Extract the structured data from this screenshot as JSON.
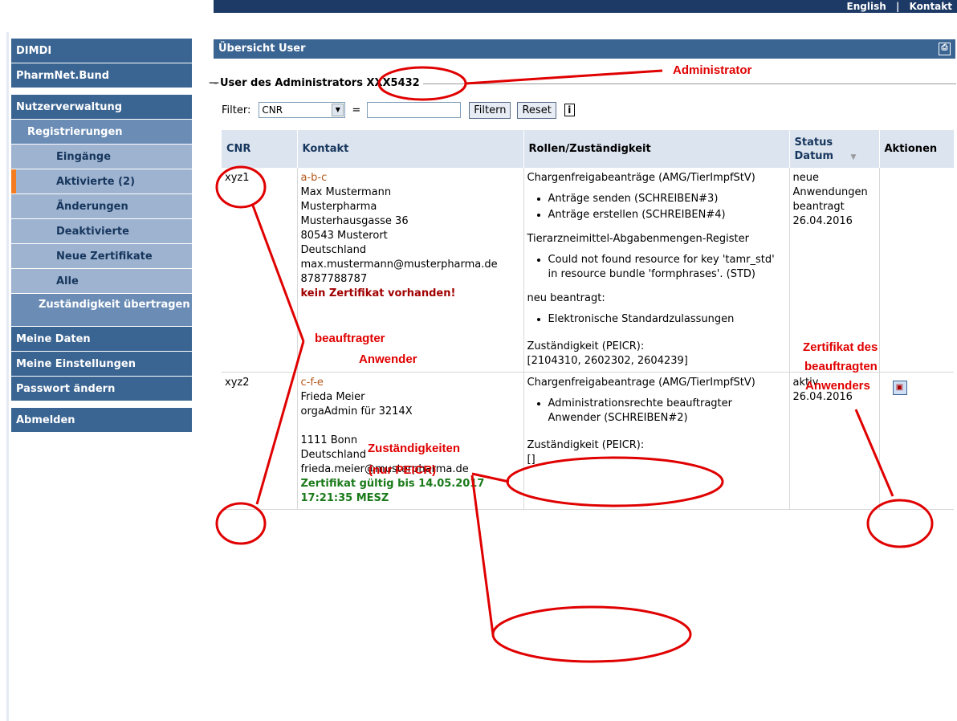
{
  "topbar": {
    "links": [
      "English",
      "Kontakt"
    ],
    "separator": "|"
  },
  "sidebar": {
    "items": [
      {
        "label": "DIMDI"
      },
      {
        "label": "PharmNet.Bund"
      },
      {
        "label": "Nutzerverwaltung"
      },
      {
        "label": "Registrierungen"
      },
      {
        "label": "Eingänge"
      },
      {
        "label": "Aktivierte (2)"
      },
      {
        "label": "Änderungen"
      },
      {
        "label": "Deaktivierte"
      },
      {
        "label": "Neue Zertifikate"
      },
      {
        "label": "Alle"
      },
      {
        "label": "Zuständigkeit übertragen"
      },
      {
        "label": "Meine Daten"
      },
      {
        "label": "Meine Einstellungen"
      },
      {
        "label": "Passwort ändern"
      },
      {
        "label": "Abmelden"
      }
    ]
  },
  "panel": {
    "title": "Übersicht User",
    "legend": "User des Administrators XXX5432"
  },
  "filter": {
    "label": "Filter:",
    "selected": "CNR",
    "equals": "=",
    "value": "",
    "filter_button": "Filtern",
    "reset_button": "Reset",
    "info": "i"
  },
  "table": {
    "headers": {
      "cnr": "CNR",
      "kontakt": "Kontakt",
      "rollen": "Rollen/Zuständigkeit",
      "status": "Status Datum",
      "aktionen": "Aktionen"
    },
    "rows": [
      {
        "cnr": "xyz1",
        "kontakt_id": "a-b-c",
        "kontakt_lines": [
          "Max Mustermann",
          "Musterpharma",
          "Musterhausgasse 36",
          "80543 Musterort",
          "Deutschland",
          "max.mustermann@musterpharma.de",
          "8787788787"
        ],
        "kontakt_note": "kein Zertifikat vorhanden!",
        "rollen_head": "Chargenfreigabeanträge (AMG/TierImpfStV)",
        "rollen_items": [
          "Anträge senden (SCHREIBEN#3)",
          "Anträge erstellen (SCHREIBEN#4)"
        ],
        "rollen_head2": "Tierarzneimittel-Abgabenmengen-Register",
        "rollen_items2": [
          "Could not found resource for key 'tamr_std' in resource bundle 'formphrases'. (STD)"
        ],
        "rollen_head3": "neu beantragt:",
        "rollen_items3": [
          "Elektronische Standardzulassungen"
        ],
        "zust_label": "Zuständigkeit (PEICR):",
        "zust_value": "[2104310, 2602302, 2604239]",
        "status": "neue Anwendungen beantragt",
        "datum": "26.04.2016"
      },
      {
        "cnr": "xyz2",
        "kontakt_id": "c-f-e",
        "kontakt_lines": [
          "Frieda Meier",
          "orgaAdmin für 3214X",
          "",
          "1111 Bonn",
          "Deutschland",
          "frieda.meier@musterpharma.de"
        ],
        "kontakt_note": "Zertifikat gültig bis 14.05.2017 17:21:35 MESZ",
        "rollen_head": "Chargenfreigabeantrage (AMG/TierImpfStV)",
        "rollen_items": [
          "Administrationsrechte beauftragter Anwender (SCHREIBEN#2)"
        ],
        "zust_label": "Zuständigkeit (PEICR):",
        "zust_value": "[]",
        "status": "aktiv",
        "datum": "26.04.2016"
      }
    ]
  },
  "annotations": {
    "administrator": "Administrator",
    "beauftragter": "beauftragter",
    "anwender": "Anwender",
    "zust1": "Zuständigkeiten",
    "zust2": "(nur PEICR)",
    "zert1": "Zertifikat des",
    "zert2": "beauftragten",
    "zert3": "Anwenders",
    "color": "#e00000"
  }
}
